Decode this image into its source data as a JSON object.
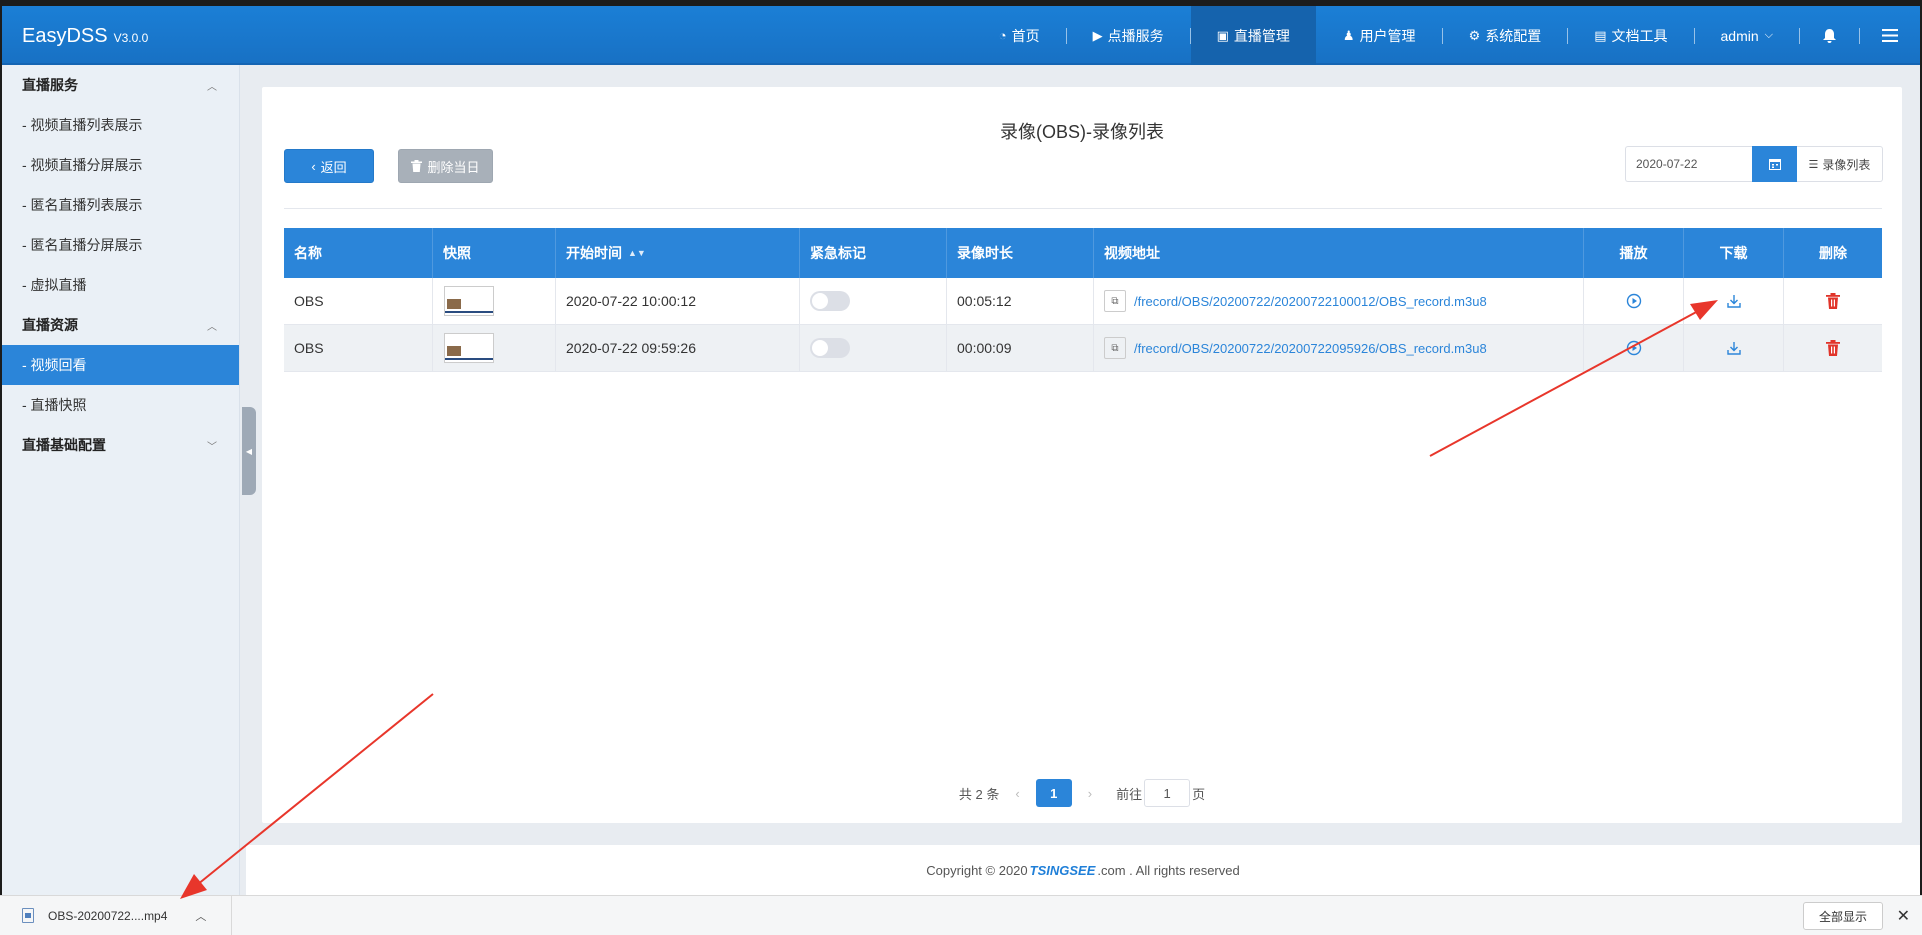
{
  "app": {
    "brand": "EasyDSS",
    "version": "V3.0.0"
  },
  "nav": {
    "items": [
      {
        "label": "首页",
        "icon": "dashboard-icon",
        "glyph": "◔",
        "active": false
      },
      {
        "label": "点播服务",
        "icon": "video-icon",
        "glyph": "▶",
        "active": false
      },
      {
        "label": "直播管理",
        "icon": "tv-icon",
        "glyph": "▣",
        "active": true
      },
      {
        "label": "用户管理",
        "icon": "user-icon",
        "glyph": "♟",
        "active": false
      },
      {
        "label": "系统配置",
        "icon": "gear-icon",
        "glyph": "⚙",
        "active": false
      },
      {
        "label": "文档工具",
        "icon": "book-icon",
        "glyph": "▤",
        "active": false
      }
    ],
    "user": "admin"
  },
  "sidebar": {
    "groups": [
      {
        "title": "直播服务",
        "items": [
          "- 视频直播列表展示",
          "- 视频直播分屏展示",
          "- 匿名直播列表展示",
          "- 匿名直播分屏展示",
          "- 虚拟直播"
        ]
      },
      {
        "title": "直播资源",
        "items": [
          "- 视频回看",
          "- 直播快照"
        ]
      },
      {
        "title": "直播基础配置",
        "items": []
      }
    ],
    "active_item": "- 视频回看"
  },
  "page": {
    "title": "录像(OBS)-录像列表",
    "back_label": "返回",
    "delete_day_label": "删除当日",
    "date_value": "2020-07-22",
    "record_list_label": "录像列表"
  },
  "table": {
    "headers": [
      "名称",
      "快照",
      "开始时间",
      "紧急标记",
      "录像时长",
      "视频地址",
      "播放",
      "下载",
      "删除"
    ],
    "rows": [
      {
        "name": "OBS",
        "start": "2020-07-22 10:00:12",
        "duration": "00:05:12",
        "url": "/frecord/OBS/20200722/20200722100012/OBS_record.m3u8"
      },
      {
        "name": "OBS",
        "start": "2020-07-22 09:59:26",
        "duration": "00:00:09",
        "url": "/frecord/OBS/20200722/20200722095926/OBS_record.m3u8"
      }
    ]
  },
  "pagination": {
    "total": "共 2 条",
    "current": "1",
    "goto_prefix": "前往",
    "goto_value": "1",
    "goto_suffix": "页"
  },
  "footer": {
    "prefix": "Copyright © 2020",
    "brand": "TSINGSEE",
    "suffix": ".com . All rights reserved"
  },
  "download_bar": {
    "file": "OBS-20200722....mp4",
    "show_all": "全部显示"
  },
  "colors": {
    "primary": "#2b85d9",
    "danger": "#e1342a",
    "annotation": "#e8362b"
  }
}
